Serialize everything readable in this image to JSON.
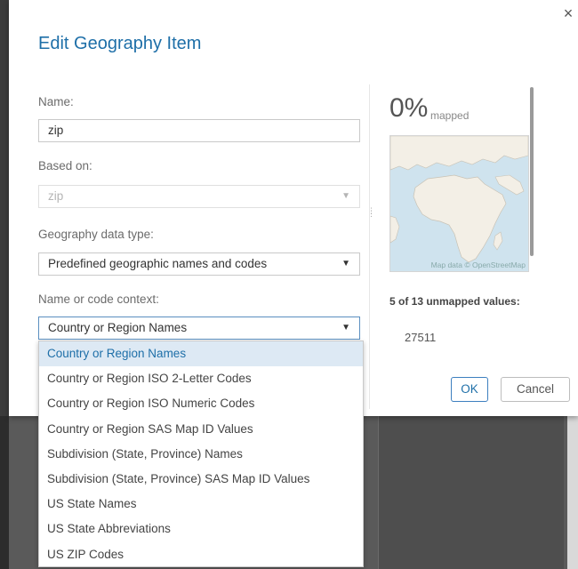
{
  "dialog": {
    "title": "Edit Geography Item",
    "close_icon": "close-icon",
    "name": {
      "label": "Name:",
      "value": "zip"
    },
    "based_on": {
      "label": "Based on:",
      "value": "zip"
    },
    "geo_type": {
      "label": "Geography data type:",
      "value": "Predefined geographic names and codes"
    },
    "context": {
      "label": "Name or code context:",
      "value": "Country or Region Names",
      "options": [
        "Country or Region Names",
        "Country or Region ISO 2-Letter Codes",
        "Country or Region ISO Numeric Codes",
        "Country or Region SAS Map ID Values",
        "Subdivision (State, Province) Names",
        "Subdivision (State, Province) SAS Map ID Values",
        "US State Names",
        "US State Abbreviations",
        "US ZIP Codes"
      ],
      "selected_index": 0
    },
    "preview": {
      "percent": "0%",
      "percent_label": "mapped",
      "map_credit": "Map data © OpenStreetMap",
      "unmapped_title": "5 of 13 unmapped values:",
      "unmapped_values": [
        "27511"
      ]
    },
    "buttons": {
      "ok": "OK",
      "cancel": "Cancel"
    }
  },
  "colors": {
    "accent": "#1e6fa8",
    "selected_bg": "#dde9f4",
    "map_water": "#cfe3ee",
    "map_land": "#f3efe6"
  }
}
